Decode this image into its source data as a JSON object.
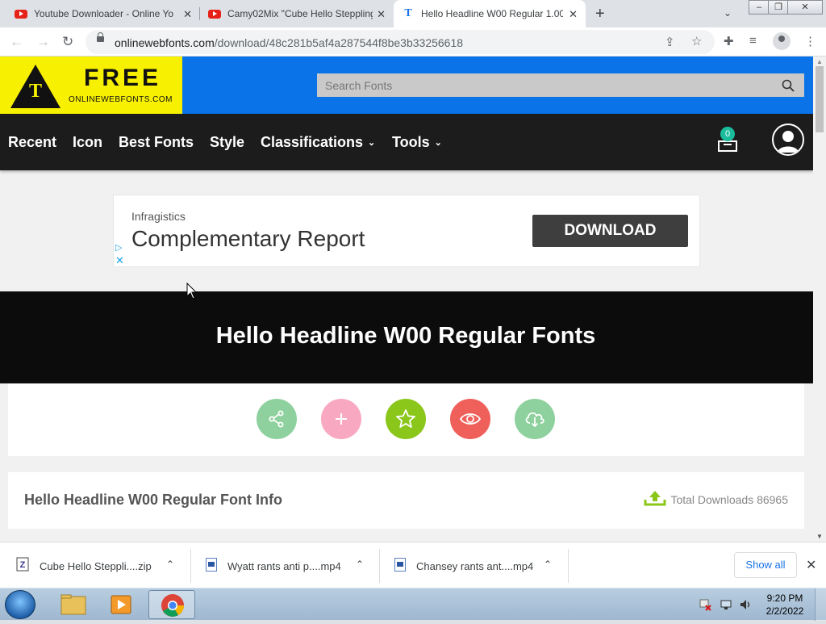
{
  "tabs": [
    {
      "title": "Youtube Downloader - Online Yo",
      "favicon": "youtube-icon"
    },
    {
      "title": "Camy02Mix \"Cube Hello Steppling",
      "favicon": "youtube-icon"
    },
    {
      "title": "Hello Headline W00 Regular 1.00",
      "favicon": "onlinewebfonts-icon",
      "active": true
    }
  ],
  "toolbar": {
    "url_host": "onlinewebfonts.com",
    "url_path": "/download/48c281b5af4a287544f8be3b33256618"
  },
  "site": {
    "logo_free": "FREE",
    "logo_sub": "ONLINEWEBFONTS.COM",
    "logo_letter": "T",
    "search_placeholder": "Search Fonts",
    "nav": [
      "Recent",
      "Icon",
      "Best Fonts",
      "Style",
      "Classifications",
      "Tools"
    ],
    "cart_count": "0"
  },
  "ad": {
    "brand": "Infragistics",
    "headline": "Complementary Report",
    "button": "DOWNLOAD"
  },
  "hero": {
    "title": "Hello Headline W00 Regular Fonts"
  },
  "actions": [
    {
      "name": "share",
      "color": "#8fd19e"
    },
    {
      "name": "add",
      "color": "#f8a8c0"
    },
    {
      "name": "favorite",
      "color": "#8bc61a"
    },
    {
      "name": "view",
      "color": "#f0605a"
    },
    {
      "name": "download",
      "color": "#8fd19e"
    }
  ],
  "info": {
    "title": "Hello Headline W00 Regular Font Info",
    "downloads": "Total Downloads 86965"
  },
  "downloads": [
    {
      "name": "Cube Hello Steppli....zip"
    },
    {
      "name": "Wyatt rants anti p....mp4"
    },
    {
      "name": "Chansey rants ant....mp4"
    }
  ],
  "downloads_show_all": "Show all",
  "taskbar": {
    "time": "9:20 PM",
    "date": "2/2/2022"
  },
  "colors": {
    "logo_yellow": "#f7f000",
    "header_blue": "#0a73e8",
    "nav_dark": "#1c1c1c",
    "hero_black": "#0c0c0c"
  }
}
